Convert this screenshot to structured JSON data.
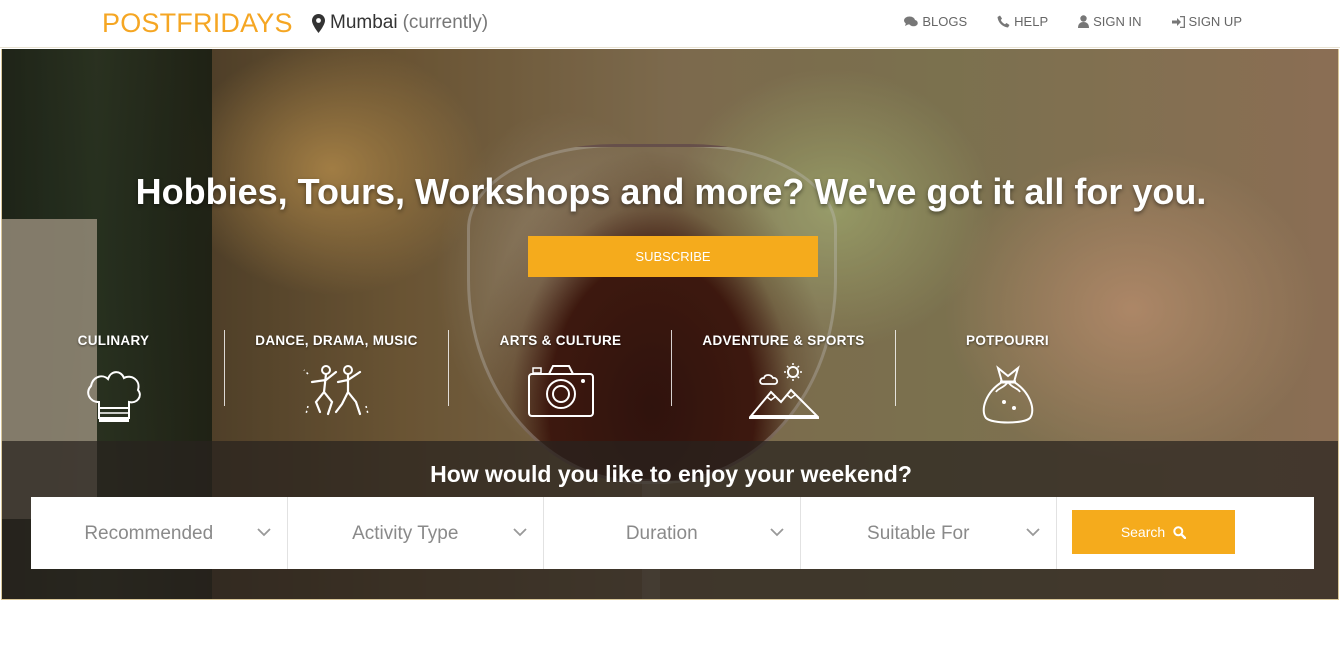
{
  "header": {
    "logo": "POSTFRIDAYS",
    "location": {
      "city": "Mumbai",
      "note": "(currently)"
    },
    "nav": [
      {
        "label": "BLOGS",
        "icon": "comments-icon"
      },
      {
        "label": "HELP",
        "icon": "phone-icon"
      },
      {
        "label": "SIGN IN",
        "icon": "user-icon"
      },
      {
        "label": "SIGN UP",
        "icon": "sign-in-icon"
      }
    ]
  },
  "hero": {
    "tagline": "Hobbies, Tours, Workshops and more? We've got it all for you.",
    "subscribe_label": "SUBSCRIBE",
    "categories": [
      {
        "label": "CULINARY",
        "icon": "chef-hat-icon"
      },
      {
        "label": "DANCE, DRAMA, MUSIC",
        "icon": "dancers-icon"
      },
      {
        "label": "ARTS & CULTURE",
        "icon": "camera-icon"
      },
      {
        "label": "ADVENTURE & SPORTS",
        "icon": "mountains-icon"
      },
      {
        "label": "POTPOURRI",
        "icon": "gift-bag-icon"
      }
    ],
    "question": "How would you like to enjoy your weekend?"
  },
  "filters": [
    {
      "label": "Recommended"
    },
    {
      "label": "Activity Type"
    },
    {
      "label": "Duration"
    },
    {
      "label": "Suitable For"
    }
  ],
  "search_label": "Search",
  "colors": {
    "accent": "#f5ab1c",
    "logo": "#f5a623"
  }
}
